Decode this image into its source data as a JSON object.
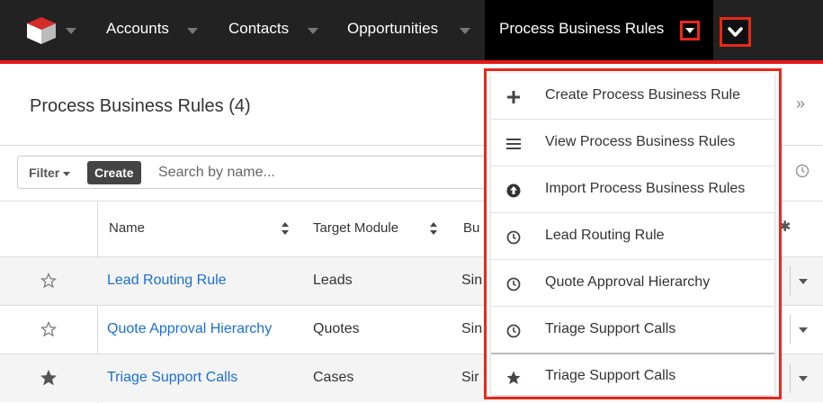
{
  "nav": {
    "items": [
      {
        "label": "Accounts"
      },
      {
        "label": "Contacts"
      },
      {
        "label": "Opportunities"
      }
    ],
    "active_label": "Process Business Rules",
    "accent": "#e61718"
  },
  "header": {
    "title": "Process Business Rules (4)"
  },
  "filter": {
    "filter_label": "Filter",
    "create_label": "Create",
    "search_placeholder": "Search by name..."
  },
  "table": {
    "columns": [
      "Name",
      "Target Module",
      "Bu"
    ],
    "rows": [
      {
        "name": "Lead Routing Rule",
        "target_module": "Leads",
        "bu": "Sin",
        "favorite": false
      },
      {
        "name": "Quote Approval Hierarchy",
        "target_module": "Quotes",
        "bu": "Sin",
        "favorite": false
      },
      {
        "name": "Triage Support Calls",
        "target_module": "Cases",
        "bu": "Sir",
        "favorite": true
      }
    ]
  },
  "menu": {
    "items": [
      {
        "label": "Create Process Business Rule",
        "icon": "plus-icon"
      },
      {
        "label": "View Process Business Rules",
        "icon": "list-icon"
      },
      {
        "label": "Import Process Business Rules",
        "icon": "upload-circle-icon"
      },
      {
        "label": "Lead Routing Rule",
        "icon": "clock-icon"
      },
      {
        "label": "Quote Approval Hierarchy",
        "icon": "clock-icon"
      },
      {
        "label": "Triage Support Calls",
        "icon": "clock-icon"
      },
      {
        "label": "Triage Support Calls",
        "icon": "star-icon"
      }
    ]
  }
}
